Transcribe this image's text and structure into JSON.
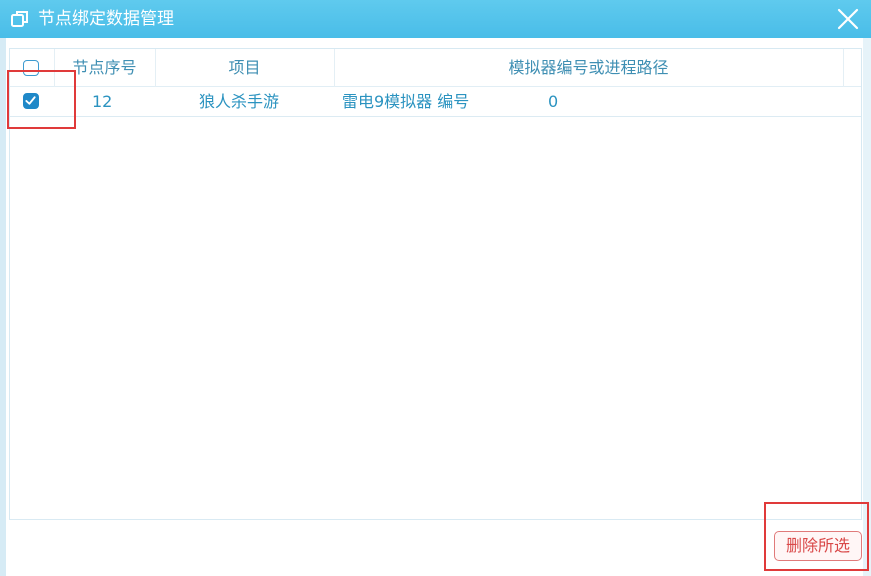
{
  "window": {
    "title": "节点绑定数据管理",
    "icons": {
      "title": "window-restore-icon",
      "close": "close-icon"
    }
  },
  "table": {
    "columns": [
      "节点序号",
      "项目",
      "模拟器编号或进程路径"
    ],
    "rows": [
      {
        "selected": true,
        "node_no": "12",
        "project": "狼人杀手游",
        "emulator": "雷电9模拟器 编号",
        "emulator_no": "0"
      }
    ]
  },
  "footer": {
    "delete_selected_label": "删除所选"
  },
  "colors": {
    "titlebar": "#4fc1ea",
    "text_accent": "#2b93c0",
    "checkbox": "#1f88c8",
    "highlight": "#e03a3a",
    "danger": "#d94848"
  }
}
